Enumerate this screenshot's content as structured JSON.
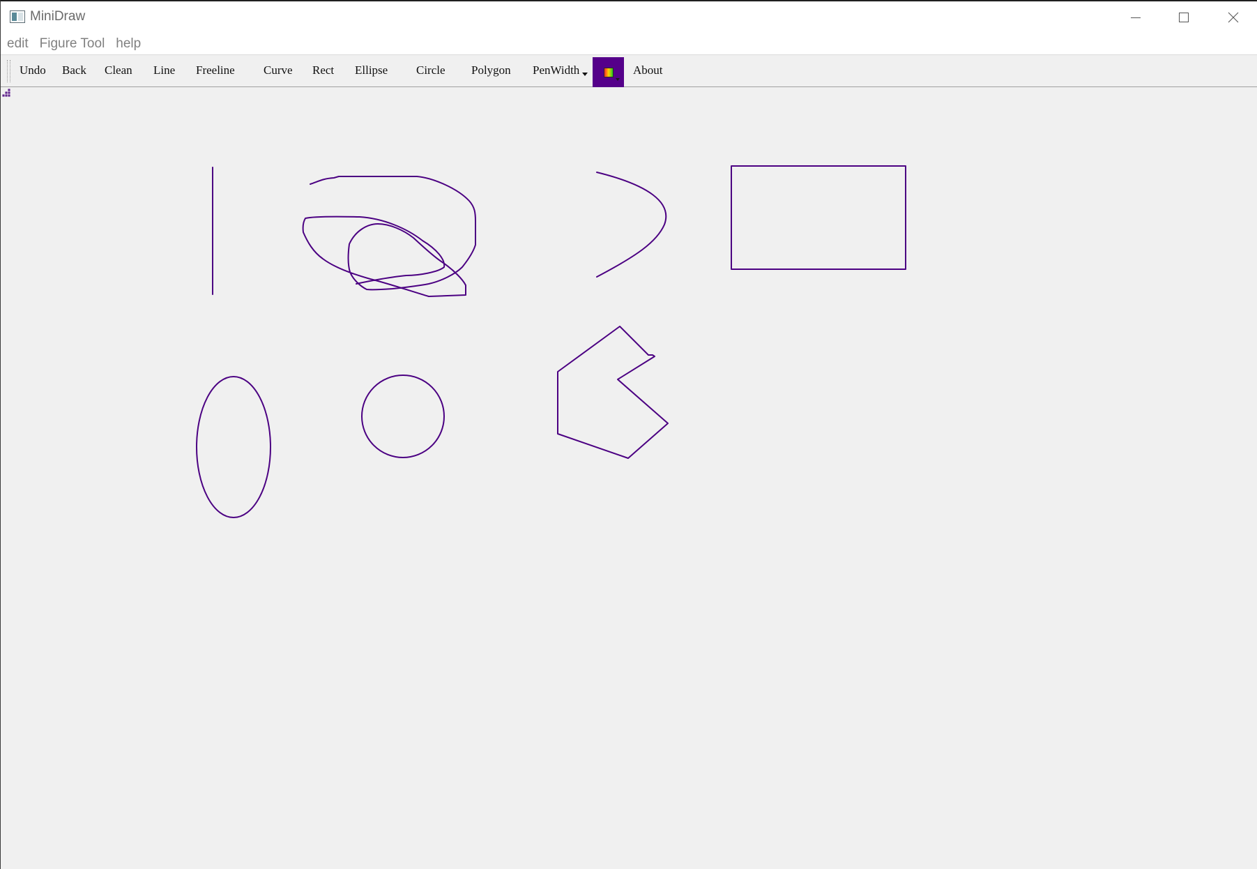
{
  "window": {
    "title": "MiniDraw"
  },
  "menubar": {
    "items": [
      "edit",
      "Figure Tool",
      "help"
    ]
  },
  "toolbar": {
    "undo": "Undo",
    "back": "Back",
    "clean": "Clean",
    "line": "Line",
    "freeline": "Freeline",
    "curve": "Curve",
    "rect": "Rect",
    "ellipse": "Ellipse",
    "circle": "Circle",
    "polygon": "Polygon",
    "penwidth": "PenWidth",
    "about": "About"
  },
  "pen": {
    "color": "#4b0082"
  },
  "colors": {
    "color_button_bg": "#55008a",
    "canvas_bg": "#f0f0f0"
  },
  "icons": [
    "app-icon",
    "minimize-icon",
    "maximize-icon",
    "close-icon",
    "color-picker-icon",
    "resize-grip-icon"
  ]
}
